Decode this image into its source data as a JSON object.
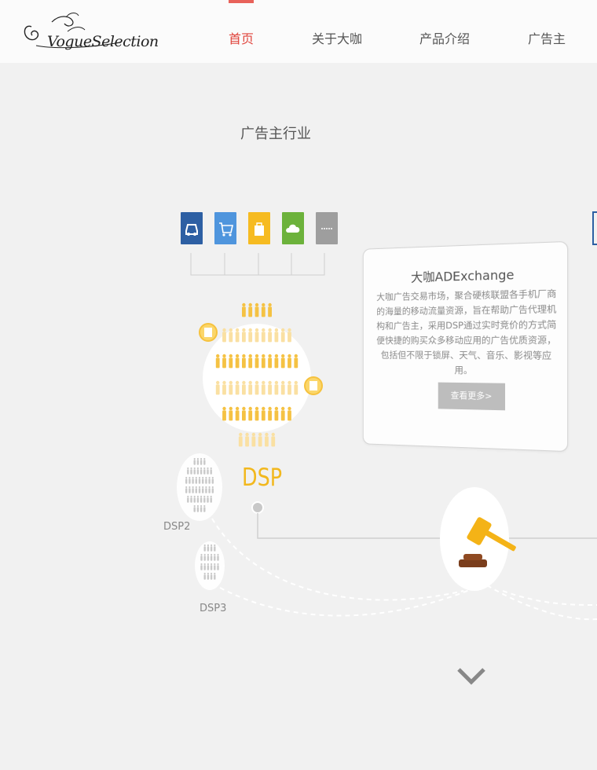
{
  "header": {
    "logo": "VogueSelection",
    "nav": [
      "首页",
      "关于大咖",
      "产品介绍",
      "广告主"
    ],
    "active_index": 0
  },
  "section": {
    "title": "广告主行业"
  },
  "industry_icons": [
    {
      "name": "car-icon",
      "color": "#2d5fa3"
    },
    {
      "name": "shopping-cart-icon",
      "color": "#4f95dd"
    },
    {
      "name": "shopping-bag-icon",
      "color": "#f6bb21"
    },
    {
      "name": "cloud-icon",
      "color": "#6cb23b"
    },
    {
      "name": "more-icon",
      "color": "#9e9e9e"
    }
  ],
  "card": {
    "title": "大咖ADExchange",
    "body": "大咖广告交易市场，聚合硬核联盟各手机厂商的海量的移动流量资源，旨在帮助广告代理机构和广告主，采用DSP通过实时竞价的方式简便快捷的购买众多移动应用的广告优质资源，包括但不限于锁屏、天气、音乐、影视等应用。",
    "button": "查看更多>"
  },
  "diagram": {
    "dsp_label": "DSP",
    "dsp2_label": "DSP2",
    "dsp3_label": "DSP3"
  },
  "colors": {
    "accent": "#e0443c",
    "dsp": "#f2b81e",
    "gavel": "#f4b317",
    "gavel_base": "#7a3d1c"
  }
}
